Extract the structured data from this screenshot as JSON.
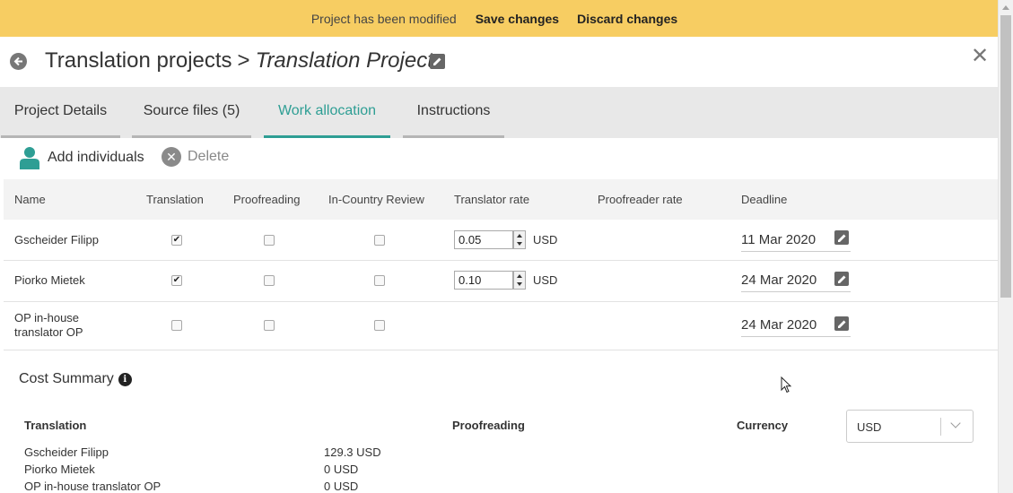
{
  "banner": {
    "message": "Project has been modified",
    "save_label": "Save changes",
    "discard_label": "Discard changes"
  },
  "header": {
    "breadcrumb_parent": "Translation projects",
    "separator": ">",
    "project_name": "Translation Project",
    "close_symbol": "✕"
  },
  "tabs": [
    {
      "label": "Project Details",
      "active": false
    },
    {
      "label": "Source files (5)",
      "active": false
    },
    {
      "label": "Work allocation",
      "active": true
    },
    {
      "label": "Instructions",
      "active": false
    }
  ],
  "toolbar": {
    "add_label": "Add individuals",
    "delete_label": "Delete"
  },
  "table": {
    "headers": {
      "name": "Name",
      "translation": "Translation",
      "proofreading": "Proofreading",
      "in_country_review": "In-Country Review",
      "translator_rate": "Translator rate",
      "proofreader_rate": "Proofreader rate",
      "deadline": "Deadline"
    },
    "rows": [
      {
        "name_line1": "Gscheider Filipp",
        "name_line2": "",
        "translation": true,
        "proofreading": false,
        "icr": false,
        "rate": "0.05",
        "currency": "USD",
        "deadline": "11 Mar 2020"
      },
      {
        "name_line1": "Piorko Mietek",
        "name_line2": "",
        "translation": true,
        "proofreading": false,
        "icr": false,
        "rate": "0.10",
        "currency": "USD",
        "deadline": "24 Mar 2020"
      },
      {
        "name_line1": "OP in-house",
        "name_line2": "translator OP",
        "translation": false,
        "proofreading": false,
        "icr": false,
        "rate": "",
        "currency": "",
        "deadline": "24 Mar 2020"
      }
    ]
  },
  "cost_summary": {
    "title": "Cost Summary",
    "translation_header": "Translation",
    "proofreading_header": "Proofreading",
    "currency_header": "Currency",
    "currency_value": "USD",
    "lines": [
      {
        "name": "Gscheider Filipp",
        "value": "129.3 USD"
      },
      {
        "name": "Piorko Mietek",
        "value": "0 USD"
      },
      {
        "name": "OP in-house translator OP",
        "value": "0 USD"
      }
    ]
  },
  "colors": {
    "banner": "#f7cd62",
    "accent": "#2e9e94",
    "tabs_bg": "#e8e8e8"
  }
}
